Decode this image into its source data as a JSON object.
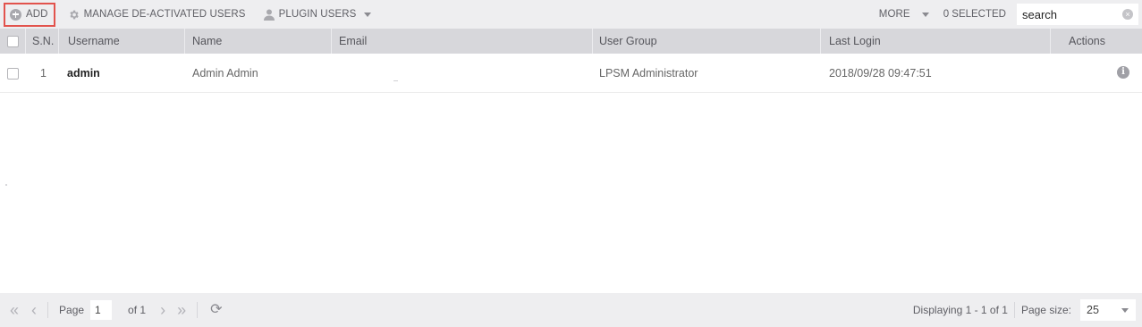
{
  "toolbar": {
    "add_label": "ADD",
    "manage_label": "MANAGE DE-ACTIVATED USERS",
    "plugin_label": "PLUGIN USERS",
    "more_label": "MORE",
    "selected_label": "0 SELECTED",
    "search_placeholder": "search"
  },
  "grid": {
    "columns": [
      "S.N.",
      "Username",
      "Name",
      "Email",
      "User Group",
      "Last Login",
      "Actions"
    ],
    "rows": [
      {
        "sn": "1",
        "username": "admin",
        "name": "Admin Admin",
        "email": "",
        "user_group": "LPSM Administrator",
        "last_login": "2018/09/28 09:47:51"
      }
    ]
  },
  "pager": {
    "page_label": "Page",
    "page_value": "1",
    "of_label": "of 1",
    "display_label": "Displaying 1 - 1 of 1",
    "page_size_label": "Page size:",
    "page_size_value": "25"
  },
  "colors": {
    "toolbar_bg": "#eeeef0",
    "header_bg": "#d7d7db",
    "add_highlight": "#e2534d"
  },
  "icons": [
    "add-circle-icon",
    "gear-icon",
    "user-icon",
    "chevron-down-icon",
    "clear-search-icon",
    "info-icon",
    "first-page-icon",
    "prev-page-icon",
    "next-page-icon",
    "last-page-icon",
    "refresh-icon"
  ]
}
